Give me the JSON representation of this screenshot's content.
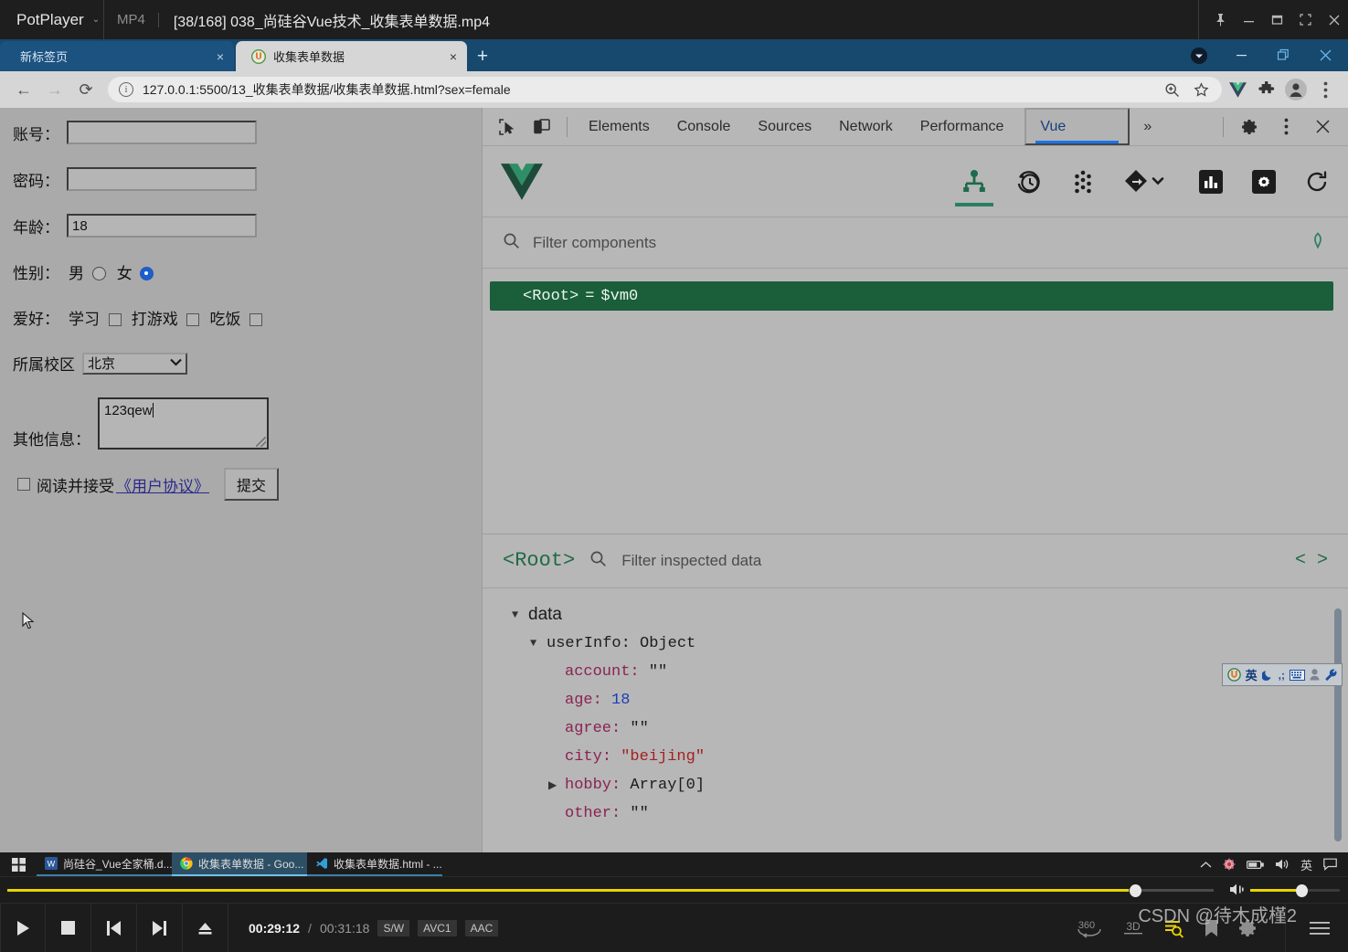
{
  "potplayer": {
    "app_name": "PotPlayer",
    "format": "MP4",
    "file_title": "[38/168] 038_尚硅谷Vue技术_收集表单数据.mp4",
    "window_buttons": [
      "pin-icon",
      "minimize-icon",
      "maximize-icon",
      "fullscreen-icon",
      "close-icon"
    ],
    "controls": {
      "play_label": "play-icon",
      "stop_label": "stop-icon",
      "prev_label": "previous-icon",
      "next_label": "next-icon",
      "eject_label": "eject-icon",
      "current_time": "00:29:12",
      "separator": "/",
      "total_time": "00:31:18",
      "chips": [
        "S/W",
        "AVC1",
        "AAC"
      ],
      "right_icons": [
        "360",
        "3D",
        "playlist-icon",
        "bookmark-icon",
        "settings-icon",
        "menu-icon"
      ],
      "progress_percent": 93,
      "volume_percent": 57
    },
    "watermark": "CSDN @待木成槿2"
  },
  "browser": {
    "tabs": [
      {
        "label": "新标签页",
        "active": false,
        "favicon": "none",
        "close": "×"
      },
      {
        "label": "收集表单数据",
        "active": true,
        "favicon": "live-server-icon",
        "close": "×"
      }
    ],
    "new_tab_label": "+",
    "window_buttons": [
      "profile-badge-icon",
      "minimize-icon",
      "restore-icon",
      "close-icon"
    ],
    "nav": {
      "back": "←",
      "forward": "→",
      "reload": "⟳"
    },
    "omnibox": {
      "info_icon": "ⓘ",
      "url": "127.0.0.1:5500/13_收集表单数据/收集表单数据.html?sex=female",
      "right_icons": [
        "zoom-icon",
        "bookmark-star-icon",
        "vue-devtools-extension-icon",
        "extensions-puzzle-icon",
        "profile-avatar-icon",
        "chrome-menu-icon"
      ]
    }
  },
  "page_form": {
    "fields": [
      {
        "label": "账号：",
        "value": "",
        "type": "text"
      },
      {
        "label": "密码：",
        "value": "",
        "type": "password"
      },
      {
        "label": "年龄：",
        "value": "18",
        "type": "number"
      }
    ],
    "gender": {
      "label": "性别：",
      "options": [
        {
          "label": "男",
          "checked": false
        },
        {
          "label": "女",
          "checked": true
        }
      ]
    },
    "hobby": {
      "label": "爱好：",
      "options": [
        {
          "label": "学习",
          "checked": false
        },
        {
          "label": "打游戏",
          "checked": false
        },
        {
          "label": "吃饭",
          "checked": false
        }
      ]
    },
    "campus": {
      "label": "所属校区",
      "selected": "北京",
      "chevron": "⌄"
    },
    "other": {
      "label": "其他信息：",
      "value": "123qew"
    },
    "agree": {
      "checked": false,
      "text_before": "阅读并接受",
      "link_text": "《用户协议》"
    },
    "submit_label": "提交"
  },
  "devtools": {
    "left_icons": [
      "inspect-element-icon",
      "device-toolbar-icon"
    ],
    "tabs": [
      {
        "label": "Elements",
        "selected": false
      },
      {
        "label": "Console",
        "selected": false
      },
      {
        "label": "Sources",
        "selected": false
      },
      {
        "label": "Network",
        "selected": false
      },
      {
        "label": "Performance",
        "selected": false
      },
      {
        "label": "Vue",
        "selected": true
      }
    ],
    "overflow_label": "»",
    "right_icons": [
      "settings-gear-icon",
      "devtools-menu-icon",
      "close-devtools-icon"
    ],
    "vue_panel": {
      "logo": "vue-logo-icon",
      "tools": [
        {
          "name": "components-tree-icon",
          "active": true
        },
        {
          "name": "timeline-history-icon",
          "active": false
        },
        {
          "name": "vuex-dots-icon",
          "active": false
        },
        {
          "name": "routes-diamond-icon",
          "active": false
        },
        {
          "name": "performance-bars-icon",
          "active": false
        },
        {
          "name": "settings-gear-icon",
          "active": false
        },
        {
          "name": "refresh-icon",
          "active": false
        }
      ],
      "filter_components_placeholder": "Filter components",
      "filter_search_icon": "search-icon",
      "select_component_icon": "target-select-icon",
      "component_tree": [
        {
          "name": "<Root>",
          "eq": "=",
          "ref": "$vm0",
          "selected": true
        }
      ],
      "inspector": {
        "root_tag": "<Root>",
        "search_icon": "search-icon",
        "filter_placeholder": "Filter inspected data",
        "code_icon": "< >",
        "rows": [
          {
            "indent": 0,
            "toggle": "▼",
            "key": "data",
            "sep": "",
            "value": "",
            "kind": "group"
          },
          {
            "indent": 1,
            "toggle": "▼",
            "key": "userInfo",
            "sep": ":",
            "value": "Object",
            "kind": "object"
          },
          {
            "indent": 2,
            "toggle": "",
            "key": "account",
            "sep": ":",
            "value": "\"\"",
            "kind": "string"
          },
          {
            "indent": 2,
            "toggle": "",
            "key": "age",
            "sep": ":",
            "value": "18",
            "kind": "number"
          },
          {
            "indent": 2,
            "toggle": "",
            "key": "agree",
            "sep": ":",
            "value": "\"\"",
            "kind": "string"
          },
          {
            "indent": 2,
            "toggle": "",
            "key": "city",
            "sep": ":",
            "value": "\"beijing\"",
            "kind": "quoted"
          },
          {
            "indent": 2,
            "toggle": "▶",
            "key": "hobby",
            "sep": ":",
            "value": "Array[0]",
            "kind": "array"
          },
          {
            "indent": 2,
            "toggle": "",
            "key": "other",
            "sep": ":",
            "value": "\"\"",
            "kind": "string"
          }
        ]
      }
    }
  },
  "ime_toolbar": {
    "items": [
      "sogou-logo-icon",
      "英",
      "moon-icon",
      "punctuation-icon",
      "keyboard-icon",
      "user-icon",
      "wrench-icon"
    ]
  },
  "taskbar": {
    "start_label": "windows-start-icon",
    "items": [
      {
        "label": "尚硅谷_Vue全家桶.d...",
        "icon": "word-icon",
        "active": false
      },
      {
        "label": "收集表单数据 - Goo...",
        "icon": "chrome-icon",
        "active": true
      },
      {
        "label": "收集表单数据.html - ...",
        "icon": "vscode-icon",
        "active": false
      }
    ],
    "tray": [
      "chevron-up-icon",
      "sogou-ime-icon",
      "battery-icon",
      "volume-icon",
      "英",
      "notifications-icon"
    ]
  }
}
